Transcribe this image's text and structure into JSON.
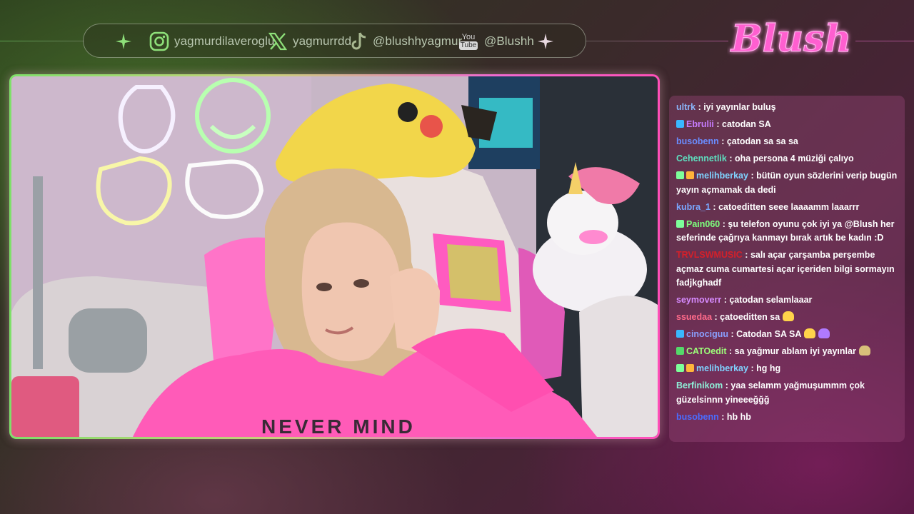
{
  "socials": {
    "instagram": {
      "icon": "instagram-icon",
      "handle": "yagmurdilaveroglu"
    },
    "x": {
      "icon": "x-icon",
      "handle": "yagmurrdd"
    },
    "tiktok": {
      "icon": "tiktok-icon",
      "handle": "@blushhyagmur"
    },
    "youtube": {
      "icon": "youtube-icon",
      "icon_text_top": "You",
      "icon_text_bottom": "Tube",
      "handle": "@Blushh"
    }
  },
  "logo": {
    "text": "Blush",
    "color": "#ff4fc8"
  },
  "colors": {
    "green_accent": "#7fe06a",
    "pink_accent": "#ff4fb8"
  },
  "chat": [
    {
      "badges": [],
      "user": "ultrk",
      "user_color": "#8ab4f8",
      "text": "iyi yayınlar buluş"
    },
    {
      "badges": [
        "cube-badge"
      ],
      "user": "Ebrulii",
      "user_color": "#c77dff",
      "text": "catodan SA"
    },
    {
      "badges": [],
      "user": "busobenn",
      "user_color": "#6a8dff",
      "text": "çatodan sa sa sa"
    },
    {
      "badges": [],
      "user": "Cehennetlik",
      "user_color": "#5ee0c0",
      "text": "oha persona 4 müziği çalıyo"
    },
    {
      "badges": [
        "gift-badge",
        "crown-badge"
      ],
      "user": "melihberkay",
      "user_color": "#7fd3ff",
      "text": "bütün oyun sözlerini verip bugün yayın açmamak da dedi"
    },
    {
      "badges": [],
      "user": "kubra_1",
      "user_color": "#7aa8ff",
      "text": "catoeditten seee laaaamm laaarrr"
    },
    {
      "badges": [
        "gift-badge"
      ],
      "user": "Pain060",
      "user_color": "#7dff7d",
      "text": "şu telefon oyunu çok iyi ya @Blush her seferinde çağrıya kanmayı bırak artık be kadın :D"
    },
    {
      "badges": [],
      "user": "TRVLSWMUSIC",
      "user_color": "#d4202a",
      "text": "salı açar çarşamba perşembe açmaz cuma cumartesi açar içeriden bilgi sormayın fadjkghadf"
    },
    {
      "badges": [],
      "user": "seymoverr",
      "user_color": "#d78bff",
      "text": "çatodan selamlaaar"
    },
    {
      "badges": [],
      "user": "ssuedaa",
      "user_color": "#ff6a8a",
      "text": "çatoeditten sa",
      "emote": "chick-emote"
    },
    {
      "badges": [
        "cube-badge"
      ],
      "user": "cinociguu",
      "user_color": "#8aa0ff",
      "text": "Catodan SA SA",
      "emote": "chick-emote",
      "emote2": "sa-emote"
    },
    {
      "badges": [
        "check-badge"
      ],
      "user": "CATOedit",
      "user_color": "#9dff7a",
      "text": "sa yağmur ablam iyi yayınlar",
      "emote": "cat-emote"
    },
    {
      "badges": [
        "gift-badge",
        "crown-badge"
      ],
      "user": "melihberkay",
      "user_color": "#7fd3ff",
      "text": "hg hg"
    },
    {
      "badges": [],
      "user": "Berfinikom",
      "user_color": "#8ef0d8",
      "text": "yaa selamm yağmuşummm çok güzelsinnn yineeeğğğ"
    },
    {
      "badges": [],
      "user": "busobenn",
      "user_color": "#4a6dff",
      "text": "hb hb"
    }
  ]
}
